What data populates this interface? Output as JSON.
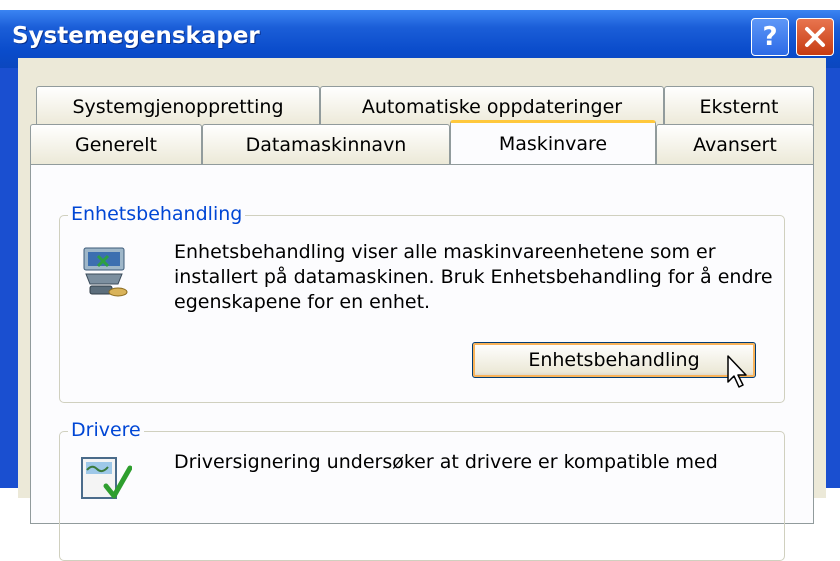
{
  "window": {
    "title": "Systemegenskaper",
    "help_label": "?",
    "close_label": "×"
  },
  "tabs_row1": [
    "Systemgjenoppretting",
    "Automatiske oppdateringer",
    "Eksternt"
  ],
  "tabs_row2": [
    "Generelt",
    "Datamaskinnavn",
    "Maskinvare",
    "Avansert"
  ],
  "selected_tab": "Maskinvare",
  "device_manager": {
    "legend": "Enhetsbehandling",
    "lines": [
      "Enhetsbehandling viser alle maskinvareenhetene som er",
      "installert på datamaskinen. Bruk Enhetsbehandling for å endre",
      "egenskapene for en enhet."
    ],
    "button_label": "Enhetsbehandling",
    "icon": "device-manager-icon"
  },
  "drivers": {
    "legend": "Drivere",
    "lines": [
      "Driversignering undersøker at drivere er kompatible med"
    ],
    "icon": "driver-signing-icon"
  },
  "colors": {
    "title_blue": "#0a4ccb",
    "group_label_blue": "#0046d5",
    "close_red": "#c63b12",
    "tab_highlight": "#ffc83c"
  }
}
